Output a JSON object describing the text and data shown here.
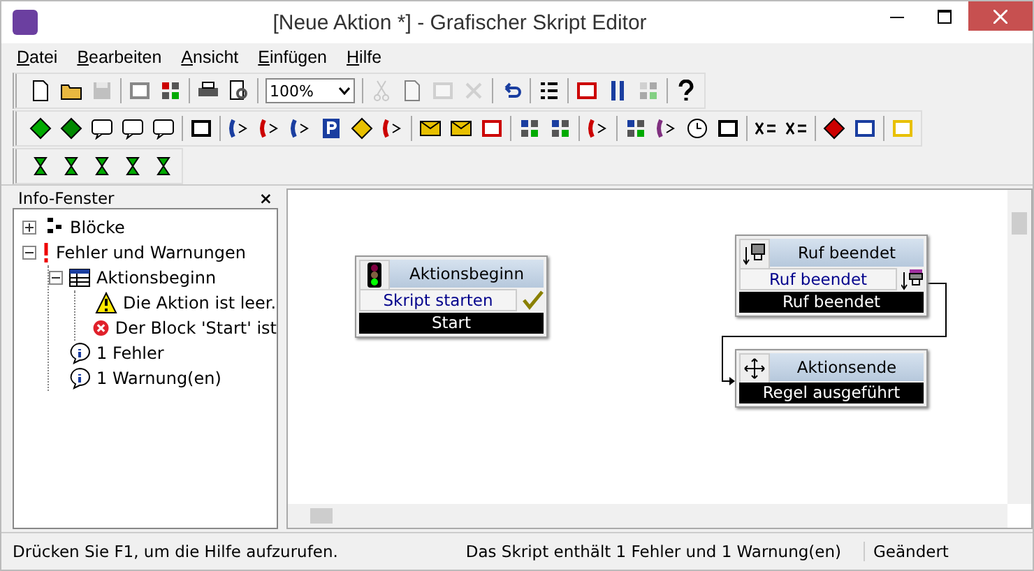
{
  "window": {
    "title": "[Neue Aktion *] - Grafischer Skript Editor"
  },
  "menu": [
    "Datei",
    "Bearbeiten",
    "Ansicht",
    "Einfügen",
    "Hilfe"
  ],
  "zoom_combo": {
    "value": "100%"
  },
  "info_panel": {
    "title": "Info-Fenster",
    "close": "×",
    "tree": [
      {
        "label": "Blöcke",
        "kind": "blocks",
        "expanded": false
      },
      {
        "label": "Fehler und Warnungen",
        "kind": "alert",
        "expanded": true,
        "children": [
          {
            "label": "Aktionsbeginn",
            "kind": "table",
            "expanded": true,
            "children": [
              {
                "label": "Die Aktion ist leer.",
                "kind": "warning"
              },
              {
                "label": "Der Block 'Start' ist",
                "kind": "error"
              }
            ]
          },
          {
            "label": "1 Fehler",
            "kind": "info"
          },
          {
            "label": "1 Warnung(en)",
            "kind": "info"
          }
        ]
      }
    ]
  },
  "canvas": {
    "blocks": [
      {
        "kind": "start",
        "title": "Aktionsbeginn",
        "field": "Skript starten",
        "footer": "Start"
      },
      {
        "kind": "call-end",
        "title": "Ruf beendet",
        "field": "Ruf beendet",
        "footer": "Ruf beendet"
      },
      {
        "kind": "end",
        "title": "Aktionsende",
        "footer": "Regel ausgeführt"
      }
    ]
  },
  "status_bar": {
    "help": "Drücken Sie F1, um die Hilfe aufzurufen.",
    "message": "Das Skript enthält 1 Fehler und 1 Warnung(en)",
    "state": "Geändert"
  }
}
